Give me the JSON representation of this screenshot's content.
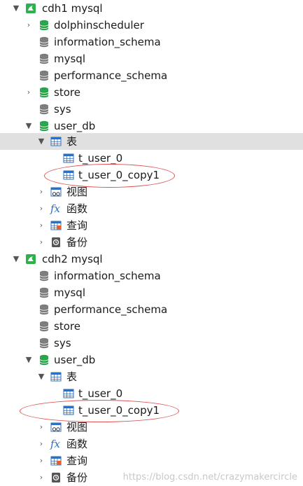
{
  "tree": {
    "conn1": {
      "label": "cdh1 mysql"
    },
    "c1_db1": {
      "label": "dolphinscheduler"
    },
    "c1_db2": {
      "label": "information_schema"
    },
    "c1_db3": {
      "label": "mysql"
    },
    "c1_db4": {
      "label": "performance_schema"
    },
    "c1_db5": {
      "label": "store"
    },
    "c1_db6": {
      "label": "sys"
    },
    "c1_db7": {
      "label": "user_db"
    },
    "c1_tables": {
      "label": "表"
    },
    "c1_t1": {
      "label": "t_user_0"
    },
    "c1_t2": {
      "label": "t_user_0_copy1"
    },
    "c1_views": {
      "label": "视图"
    },
    "c1_funcs": {
      "label": "函数"
    },
    "c1_queries": {
      "label": "查询"
    },
    "c1_backups": {
      "label": "备份"
    },
    "conn2": {
      "label": "cdh2 mysql"
    },
    "c2_db1": {
      "label": "information_schema"
    },
    "c2_db2": {
      "label": "mysql"
    },
    "c2_db3": {
      "label": "performance_schema"
    },
    "c2_db4": {
      "label": "store"
    },
    "c2_db5": {
      "label": "sys"
    },
    "c2_db6": {
      "label": "user_db"
    },
    "c2_tables": {
      "label": "表"
    },
    "c2_t1": {
      "label": "t_user_0"
    },
    "c2_t2": {
      "label": "t_user_0_copy1"
    },
    "c2_views": {
      "label": "视图"
    },
    "c2_funcs": {
      "label": "函数"
    },
    "c2_queries": {
      "label": "查询"
    },
    "c2_backups": {
      "label": "备份"
    }
  },
  "watermark": "https://blog.csdn.net/crazymakercircle",
  "colors": {
    "db_open": "#22a447",
    "db_closed": "#7a7a7a",
    "conn": "#2bb24c",
    "selection": "#e0e0e0",
    "highlight_oval": "#e05050"
  }
}
